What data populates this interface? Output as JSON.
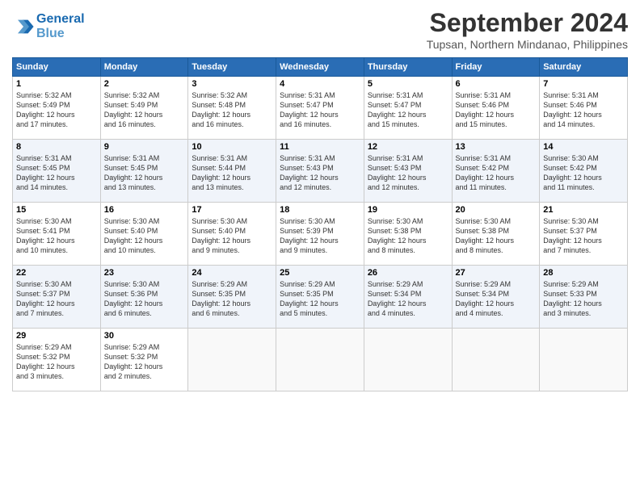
{
  "header": {
    "logo_line1": "General",
    "logo_line2": "Blue",
    "month": "September 2024",
    "location": "Tupsan, Northern Mindanao, Philippines"
  },
  "weekdays": [
    "Sunday",
    "Monday",
    "Tuesday",
    "Wednesday",
    "Thursday",
    "Friday",
    "Saturday"
  ],
  "weeks": [
    [
      {
        "day": "1",
        "lines": [
          "Sunrise: 5:32 AM",
          "Sunset: 5:49 PM",
          "Daylight: 12 hours",
          "and 17 minutes."
        ]
      },
      {
        "day": "2",
        "lines": [
          "Sunrise: 5:32 AM",
          "Sunset: 5:49 PM",
          "Daylight: 12 hours",
          "and 16 minutes."
        ]
      },
      {
        "day": "3",
        "lines": [
          "Sunrise: 5:32 AM",
          "Sunset: 5:48 PM",
          "Daylight: 12 hours",
          "and 16 minutes."
        ]
      },
      {
        "day": "4",
        "lines": [
          "Sunrise: 5:31 AM",
          "Sunset: 5:47 PM",
          "Daylight: 12 hours",
          "and 16 minutes."
        ]
      },
      {
        "day": "5",
        "lines": [
          "Sunrise: 5:31 AM",
          "Sunset: 5:47 PM",
          "Daylight: 12 hours",
          "and 15 minutes."
        ]
      },
      {
        "day": "6",
        "lines": [
          "Sunrise: 5:31 AM",
          "Sunset: 5:46 PM",
          "Daylight: 12 hours",
          "and 15 minutes."
        ]
      },
      {
        "day": "7",
        "lines": [
          "Sunrise: 5:31 AM",
          "Sunset: 5:46 PM",
          "Daylight: 12 hours",
          "and 14 minutes."
        ]
      }
    ],
    [
      {
        "day": "8",
        "lines": [
          "Sunrise: 5:31 AM",
          "Sunset: 5:45 PM",
          "Daylight: 12 hours",
          "and 14 minutes."
        ]
      },
      {
        "day": "9",
        "lines": [
          "Sunrise: 5:31 AM",
          "Sunset: 5:45 PM",
          "Daylight: 12 hours",
          "and 13 minutes."
        ]
      },
      {
        "day": "10",
        "lines": [
          "Sunrise: 5:31 AM",
          "Sunset: 5:44 PM",
          "Daylight: 12 hours",
          "and 13 minutes."
        ]
      },
      {
        "day": "11",
        "lines": [
          "Sunrise: 5:31 AM",
          "Sunset: 5:43 PM",
          "Daylight: 12 hours",
          "and 12 minutes."
        ]
      },
      {
        "day": "12",
        "lines": [
          "Sunrise: 5:31 AM",
          "Sunset: 5:43 PM",
          "Daylight: 12 hours",
          "and 12 minutes."
        ]
      },
      {
        "day": "13",
        "lines": [
          "Sunrise: 5:31 AM",
          "Sunset: 5:42 PM",
          "Daylight: 12 hours",
          "and 11 minutes."
        ]
      },
      {
        "day": "14",
        "lines": [
          "Sunrise: 5:30 AM",
          "Sunset: 5:42 PM",
          "Daylight: 12 hours",
          "and 11 minutes."
        ]
      }
    ],
    [
      {
        "day": "15",
        "lines": [
          "Sunrise: 5:30 AM",
          "Sunset: 5:41 PM",
          "Daylight: 12 hours",
          "and 10 minutes."
        ]
      },
      {
        "day": "16",
        "lines": [
          "Sunrise: 5:30 AM",
          "Sunset: 5:40 PM",
          "Daylight: 12 hours",
          "and 10 minutes."
        ]
      },
      {
        "day": "17",
        "lines": [
          "Sunrise: 5:30 AM",
          "Sunset: 5:40 PM",
          "Daylight: 12 hours",
          "and 9 minutes."
        ]
      },
      {
        "day": "18",
        "lines": [
          "Sunrise: 5:30 AM",
          "Sunset: 5:39 PM",
          "Daylight: 12 hours",
          "and 9 minutes."
        ]
      },
      {
        "day": "19",
        "lines": [
          "Sunrise: 5:30 AM",
          "Sunset: 5:38 PM",
          "Daylight: 12 hours",
          "and 8 minutes."
        ]
      },
      {
        "day": "20",
        "lines": [
          "Sunrise: 5:30 AM",
          "Sunset: 5:38 PM",
          "Daylight: 12 hours",
          "and 8 minutes."
        ]
      },
      {
        "day": "21",
        "lines": [
          "Sunrise: 5:30 AM",
          "Sunset: 5:37 PM",
          "Daylight: 12 hours",
          "and 7 minutes."
        ]
      }
    ],
    [
      {
        "day": "22",
        "lines": [
          "Sunrise: 5:30 AM",
          "Sunset: 5:37 PM",
          "Daylight: 12 hours",
          "and 7 minutes."
        ]
      },
      {
        "day": "23",
        "lines": [
          "Sunrise: 5:30 AM",
          "Sunset: 5:36 PM",
          "Daylight: 12 hours",
          "and 6 minutes."
        ]
      },
      {
        "day": "24",
        "lines": [
          "Sunrise: 5:29 AM",
          "Sunset: 5:35 PM",
          "Daylight: 12 hours",
          "and 6 minutes."
        ]
      },
      {
        "day": "25",
        "lines": [
          "Sunrise: 5:29 AM",
          "Sunset: 5:35 PM",
          "Daylight: 12 hours",
          "and 5 minutes."
        ]
      },
      {
        "day": "26",
        "lines": [
          "Sunrise: 5:29 AM",
          "Sunset: 5:34 PM",
          "Daylight: 12 hours",
          "and 4 minutes."
        ]
      },
      {
        "day": "27",
        "lines": [
          "Sunrise: 5:29 AM",
          "Sunset: 5:34 PM",
          "Daylight: 12 hours",
          "and 4 minutes."
        ]
      },
      {
        "day": "28",
        "lines": [
          "Sunrise: 5:29 AM",
          "Sunset: 5:33 PM",
          "Daylight: 12 hours",
          "and 3 minutes."
        ]
      }
    ],
    [
      {
        "day": "29",
        "lines": [
          "Sunrise: 5:29 AM",
          "Sunset: 5:32 PM",
          "Daylight: 12 hours",
          "and 3 minutes."
        ]
      },
      {
        "day": "30",
        "lines": [
          "Sunrise: 5:29 AM",
          "Sunset: 5:32 PM",
          "Daylight: 12 hours",
          "and 2 minutes."
        ]
      },
      {
        "day": "",
        "lines": []
      },
      {
        "day": "",
        "lines": []
      },
      {
        "day": "",
        "lines": []
      },
      {
        "day": "",
        "lines": []
      },
      {
        "day": "",
        "lines": []
      }
    ]
  ]
}
